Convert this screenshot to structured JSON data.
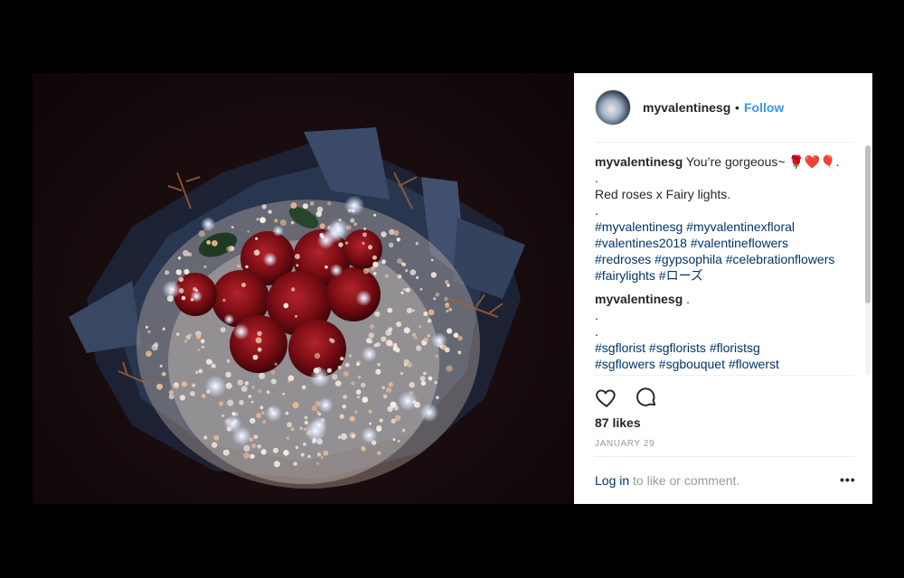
{
  "post": {
    "image_alt": "bouquet-photo",
    "header": {
      "username": "myvalentinesg",
      "separator": "•",
      "follow_label": "Follow"
    },
    "caption": {
      "username": "myvalentinesg",
      "text": "You’re gorgeous~ 🌹❤️🎈.",
      "lines": [
        ".",
        "Red roses x Fairy lights.",
        "."
      ],
      "hashtags": "#myvalentinesg #myvalentinexfloral #valentines2018 #valentineflowers #redroses #gypsophila #celebrationflowers #fairylights #ローズ"
    },
    "comment": {
      "username": "myvalentinesg",
      "text": " .",
      "lines": [
        ".",
        "."
      ],
      "hashtags": "#sgflorist #sgflorists #floristsg",
      "hashtags_cut": "#sgflowers #sgbouquet #flowerst"
    },
    "likes": "87 likes",
    "date": "JANUARY 29",
    "footer": {
      "login_label": "Log in",
      "rest": " to like or comment.",
      "more": "•••"
    }
  },
  "colors": {
    "accent": "#3897f0",
    "link": "#003569",
    "text": "#262626",
    "muted": "#999999",
    "backdrop": "#000000"
  },
  "icons": {
    "like": "heart-icon",
    "comment": "comment-bubble-icon",
    "more": "more-options-icon"
  }
}
